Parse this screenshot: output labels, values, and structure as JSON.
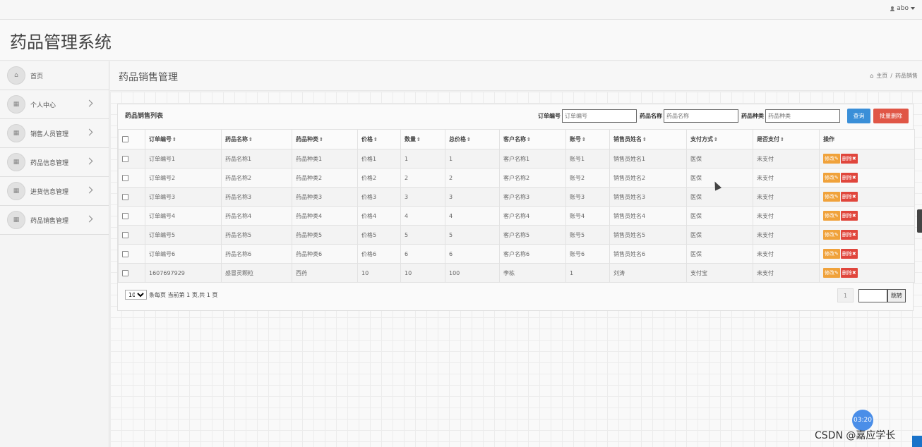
{
  "topbar": {
    "user": "abo"
  },
  "brand": {
    "title": "药品管理系统"
  },
  "sidebar": {
    "items": [
      {
        "label": "首页",
        "arrow": false
      },
      {
        "label": "个人中心",
        "arrow": true
      },
      {
        "label": "销售人员管理",
        "arrow": true
      },
      {
        "label": "药品信息管理",
        "arrow": true
      },
      {
        "label": "进货信息管理",
        "arrow": true
      },
      {
        "label": "药品销售管理",
        "arrow": true
      }
    ]
  },
  "header": {
    "page_title": "药品销售管理",
    "breadcrumb_home": "主页",
    "breadcrumb_sep": "/",
    "breadcrumb_current": "药品销售"
  },
  "panel": {
    "title": "药品销售列表",
    "search": {
      "order_label": "订单编号",
      "order_placeholder": "订单编号",
      "name_label": "药品名称",
      "name_placeholder": "药品名称",
      "type_label": "药品种类",
      "type_placeholder": "药品种类",
      "query_button": "查询",
      "batch_delete_button": "批量删除"
    },
    "columns": [
      "订单编号",
      "药品名称",
      "药品种类",
      "价格",
      "数量",
      "总价格",
      "客户名称",
      "账号",
      "销售员姓名",
      "支付方式",
      "是否支付"
    ],
    "action_header": "操作",
    "edit_label": "修改",
    "delete_label": "删除",
    "rows": [
      [
        "订单编号1",
        "药品名称1",
        "药品种类1",
        "价格1",
        "1",
        "1",
        "客户名称1",
        "账号1",
        "销售员姓名1",
        "医保",
        "未支付"
      ],
      [
        "订单编号2",
        "药品名称2",
        "药品种类2",
        "价格2",
        "2",
        "2",
        "客户名称2",
        "账号2",
        "销售员姓名2",
        "医保",
        "未支付"
      ],
      [
        "订单编号3",
        "药品名称3",
        "药品种类3",
        "价格3",
        "3",
        "3",
        "客户名称3",
        "账号3",
        "销售员姓名3",
        "医保",
        "未支付"
      ],
      [
        "订单编号4",
        "药品名称4",
        "药品种类4",
        "价格4",
        "4",
        "4",
        "客户名称4",
        "账号4",
        "销售员姓名4",
        "医保",
        "未支付"
      ],
      [
        "订单编号5",
        "药品名称5",
        "药品种类5",
        "价格5",
        "5",
        "5",
        "客户名称5",
        "账号5",
        "销售员姓名5",
        "医保",
        "未支付"
      ],
      [
        "订单编号6",
        "药品名称6",
        "药品种类6",
        "价格6",
        "6",
        "6",
        "客户名称6",
        "账号6",
        "销售员姓名6",
        "医保",
        "未支付"
      ],
      [
        "1607697929",
        "感冒灵颗粒",
        "西药",
        "10",
        "10",
        "100",
        "李栋",
        "1",
        "刘涛",
        "支付宝",
        "未支付"
      ]
    ],
    "pagination": {
      "page_size": "10",
      "summary": "条每页 当前第 1 页,共 1 页",
      "current_page": "1",
      "go_button": "跳转"
    }
  },
  "overlay": {
    "timer": "03:20",
    "watermark": "CSDN @嘉应学长"
  }
}
